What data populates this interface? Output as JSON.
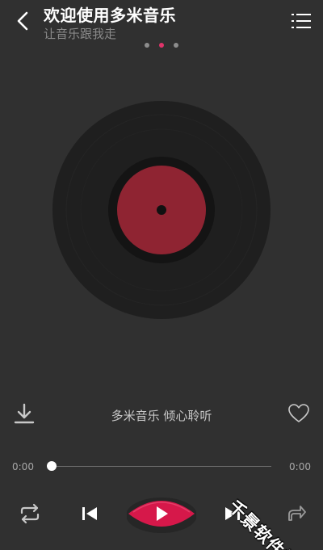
{
  "header": {
    "title": "欢迎使用多米音乐",
    "subtitle": "让音乐跟我走",
    "back_icon": "chevron-left-icon",
    "playlist_icon": "playlist-icon"
  },
  "pager": {
    "count": 3,
    "active_index": 1
  },
  "song": {
    "info": "多米音乐 倾心聆听"
  },
  "progress": {
    "current_time": "0:00",
    "total_time": "0:00",
    "fraction": 0
  },
  "controls": {
    "repeat_icon": "repeat-icon",
    "prev_icon": "skip-previous-icon",
    "play_icon": "play-icon",
    "next_icon": "skip-next-icon",
    "share_icon": "share-icon",
    "download_icon": "download-icon",
    "like_icon": "heart-outline-icon"
  },
  "watermark": {
    "text": "千景软件站"
  },
  "colors": {
    "background": "#303030",
    "accent": "#e0346a",
    "vinyl": "#1f1f1f",
    "vinyl_label": "#8f2432",
    "play_button": "#d6184a"
  }
}
